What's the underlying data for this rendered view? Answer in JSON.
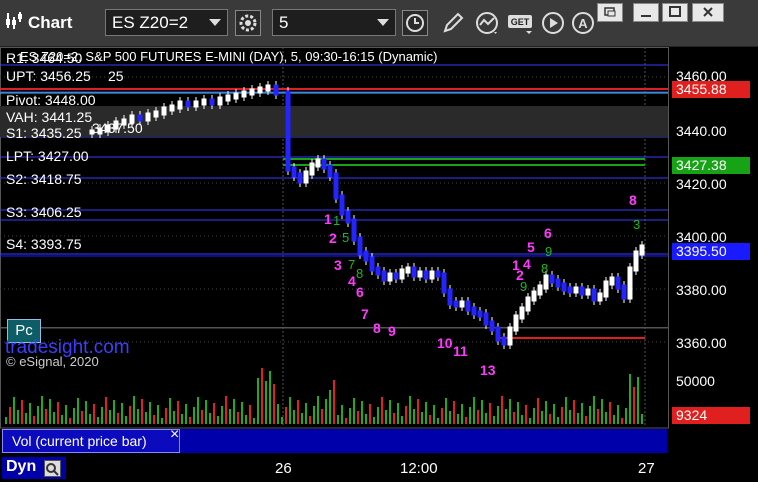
{
  "titlebar": {
    "title": "Chart",
    "symbol": "ES Z20=2",
    "interval": "5",
    "window_buttons": [
      "restore-icon",
      "minimize-icon",
      "maximize-icon",
      "close-icon"
    ]
  },
  "chart_header": "ES Z20=2, S&P 500 FUTURES E-MINI (DAY), 5, 09:30-16:15 (Dynamic)",
  "levels": {
    "r1": "R1: 3464.50",
    "upt": "UPT: 3456.25",
    "upt_extra": "25",
    "pivot": "Pivot: 3448.00",
    "vah": "VAH: 3441.25",
    "s1": "S1: 3435.25",
    "s1_extra": "3437.50",
    "lpt": "LPT: 3427.00",
    "s2": "S2: 3418.75",
    "s3": "S3: 3406.25",
    "s4": "S4: 3393.75"
  },
  "price_axis": [
    "3460.00",
    "3440.00",
    "3420.00",
    "3400.00",
    "3380.00",
    "3360.00"
  ],
  "price_tags": {
    "red": "3455.88",
    "green": "3427.38",
    "blue": "3395.50",
    "volume": "9324"
  },
  "volume_axis": "50000",
  "watermark": {
    "site": "tradesight.com",
    "copyright": "© eSignal, 2020"
  },
  "pc_button": "Pc",
  "indicator_label": "Vol (current price bar)",
  "indicator_close": "×",
  "time_axis": [
    "26",
    "12:00",
    "27"
  ],
  "footer": {
    "dyn": "Dyn"
  },
  "td_counts_magenta": [
    "1",
    "2",
    "3",
    "4",
    "6",
    "7",
    "8",
    "9",
    "10",
    "11",
    "13",
    "1",
    "2",
    "4",
    "5",
    "6",
    "8"
  ],
  "td_counts_green": [
    "1",
    "5",
    "7",
    "8",
    "9",
    "8",
    "9",
    "3"
  ],
  "colors": {
    "red_tag": "#e0201e",
    "green_tag": "#16a316",
    "blue_tag": "#1a1aff",
    "magenta": "#ff3aff",
    "level_line": "#3a3aff",
    "cyan_line": "#3fd0d0"
  }
}
